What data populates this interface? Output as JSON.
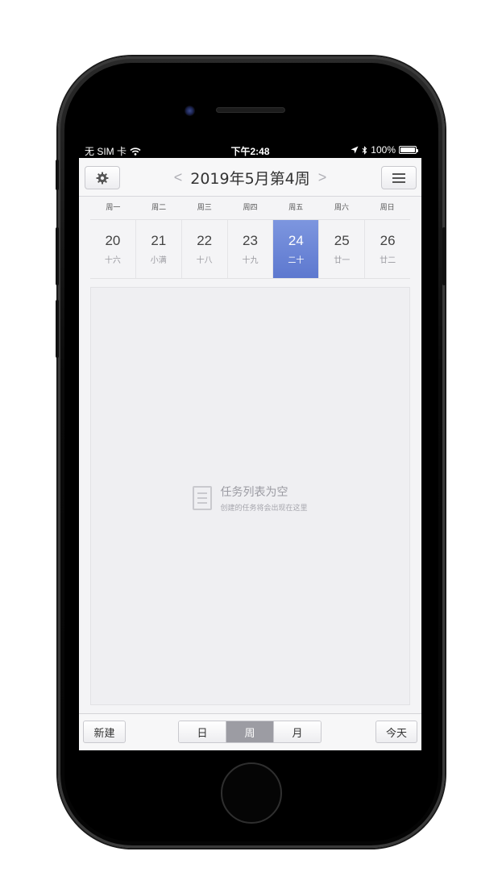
{
  "status_bar": {
    "carrier": "无 SIM 卡",
    "time": "下午2:48",
    "battery": "100%",
    "battery_level": 1.0
  },
  "nav": {
    "title": "2019年5月第4周",
    "prev_arrow": "<",
    "next_arrow": ">",
    "settings_icon": "gear-icon",
    "menu_icon": "hamburger-menu-icon"
  },
  "week": {
    "weekdays": [
      "周一",
      "周二",
      "周三",
      "周四",
      "周五",
      "周六",
      "周日"
    ],
    "days": [
      {
        "num": "20",
        "lunar": "十六"
      },
      {
        "num": "21",
        "lunar": "小满"
      },
      {
        "num": "22",
        "lunar": "十八"
      },
      {
        "num": "23",
        "lunar": "十九"
      },
      {
        "num": "24",
        "lunar": "二十"
      },
      {
        "num": "25",
        "lunar": "廿一"
      },
      {
        "num": "26",
        "lunar": "廿二"
      }
    ],
    "selected_index": 4
  },
  "empty_state": {
    "title": "任务列表为空",
    "subtitle": "创建的任务将会出现在这里",
    "icon": "task-list-icon"
  },
  "toolbar": {
    "new_label": "新建",
    "views": [
      "日",
      "周",
      "月"
    ],
    "active_view": "周",
    "today_label": "今天"
  },
  "colors": {
    "selected_day": "#6a84d6",
    "active_segment": "#9c9ca3",
    "screen_bg": "#f4f4f6"
  }
}
